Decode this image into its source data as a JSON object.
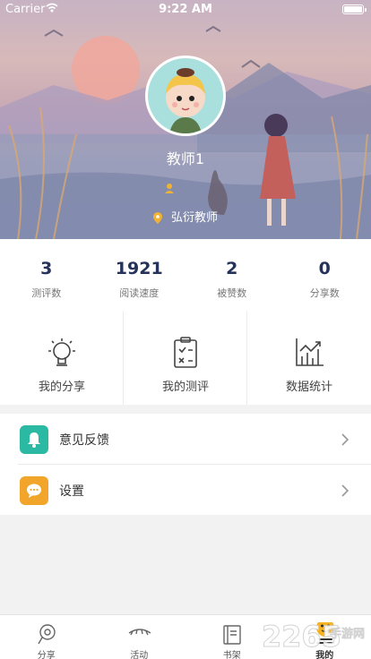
{
  "status_bar": {
    "carrier": "Carrier",
    "time": "9:22 AM"
  },
  "profile": {
    "name": "教师1",
    "school": "弘衍教师"
  },
  "stats": [
    {
      "value": "3",
      "label": "测评数"
    },
    {
      "value": "1921",
      "label": "阅读速度"
    },
    {
      "value": "2",
      "label": "被赞数"
    },
    {
      "value": "0",
      "label": "分享数"
    }
  ],
  "actions": [
    {
      "label": "我的分享",
      "icon": "bulb-icon"
    },
    {
      "label": "我的测评",
      "icon": "clipboard-icon"
    },
    {
      "label": "数据统计",
      "icon": "chart-icon"
    }
  ],
  "menu": [
    {
      "label": "意见反馈",
      "icon": "bell-icon",
      "color": "#2bb9a4"
    },
    {
      "label": "设置",
      "icon": "chat-bubble-icon",
      "color": "#f2a52b"
    }
  ],
  "tabs": [
    {
      "label": "分享",
      "icon": "share-tab-icon"
    },
    {
      "label": "活动",
      "icon": "eye-tab-icon"
    },
    {
      "label": "书架",
      "icon": "book-tab-icon"
    },
    {
      "label": "我的",
      "icon": "mine-tab-icon",
      "active": true
    }
  ],
  "watermark": {
    "number": "2265",
    "text": "手游网"
  },
  "colors": {
    "stat_value": "#25325a",
    "menu_feedback": "#2bb9a4",
    "menu_settings": "#f2a52b"
  }
}
